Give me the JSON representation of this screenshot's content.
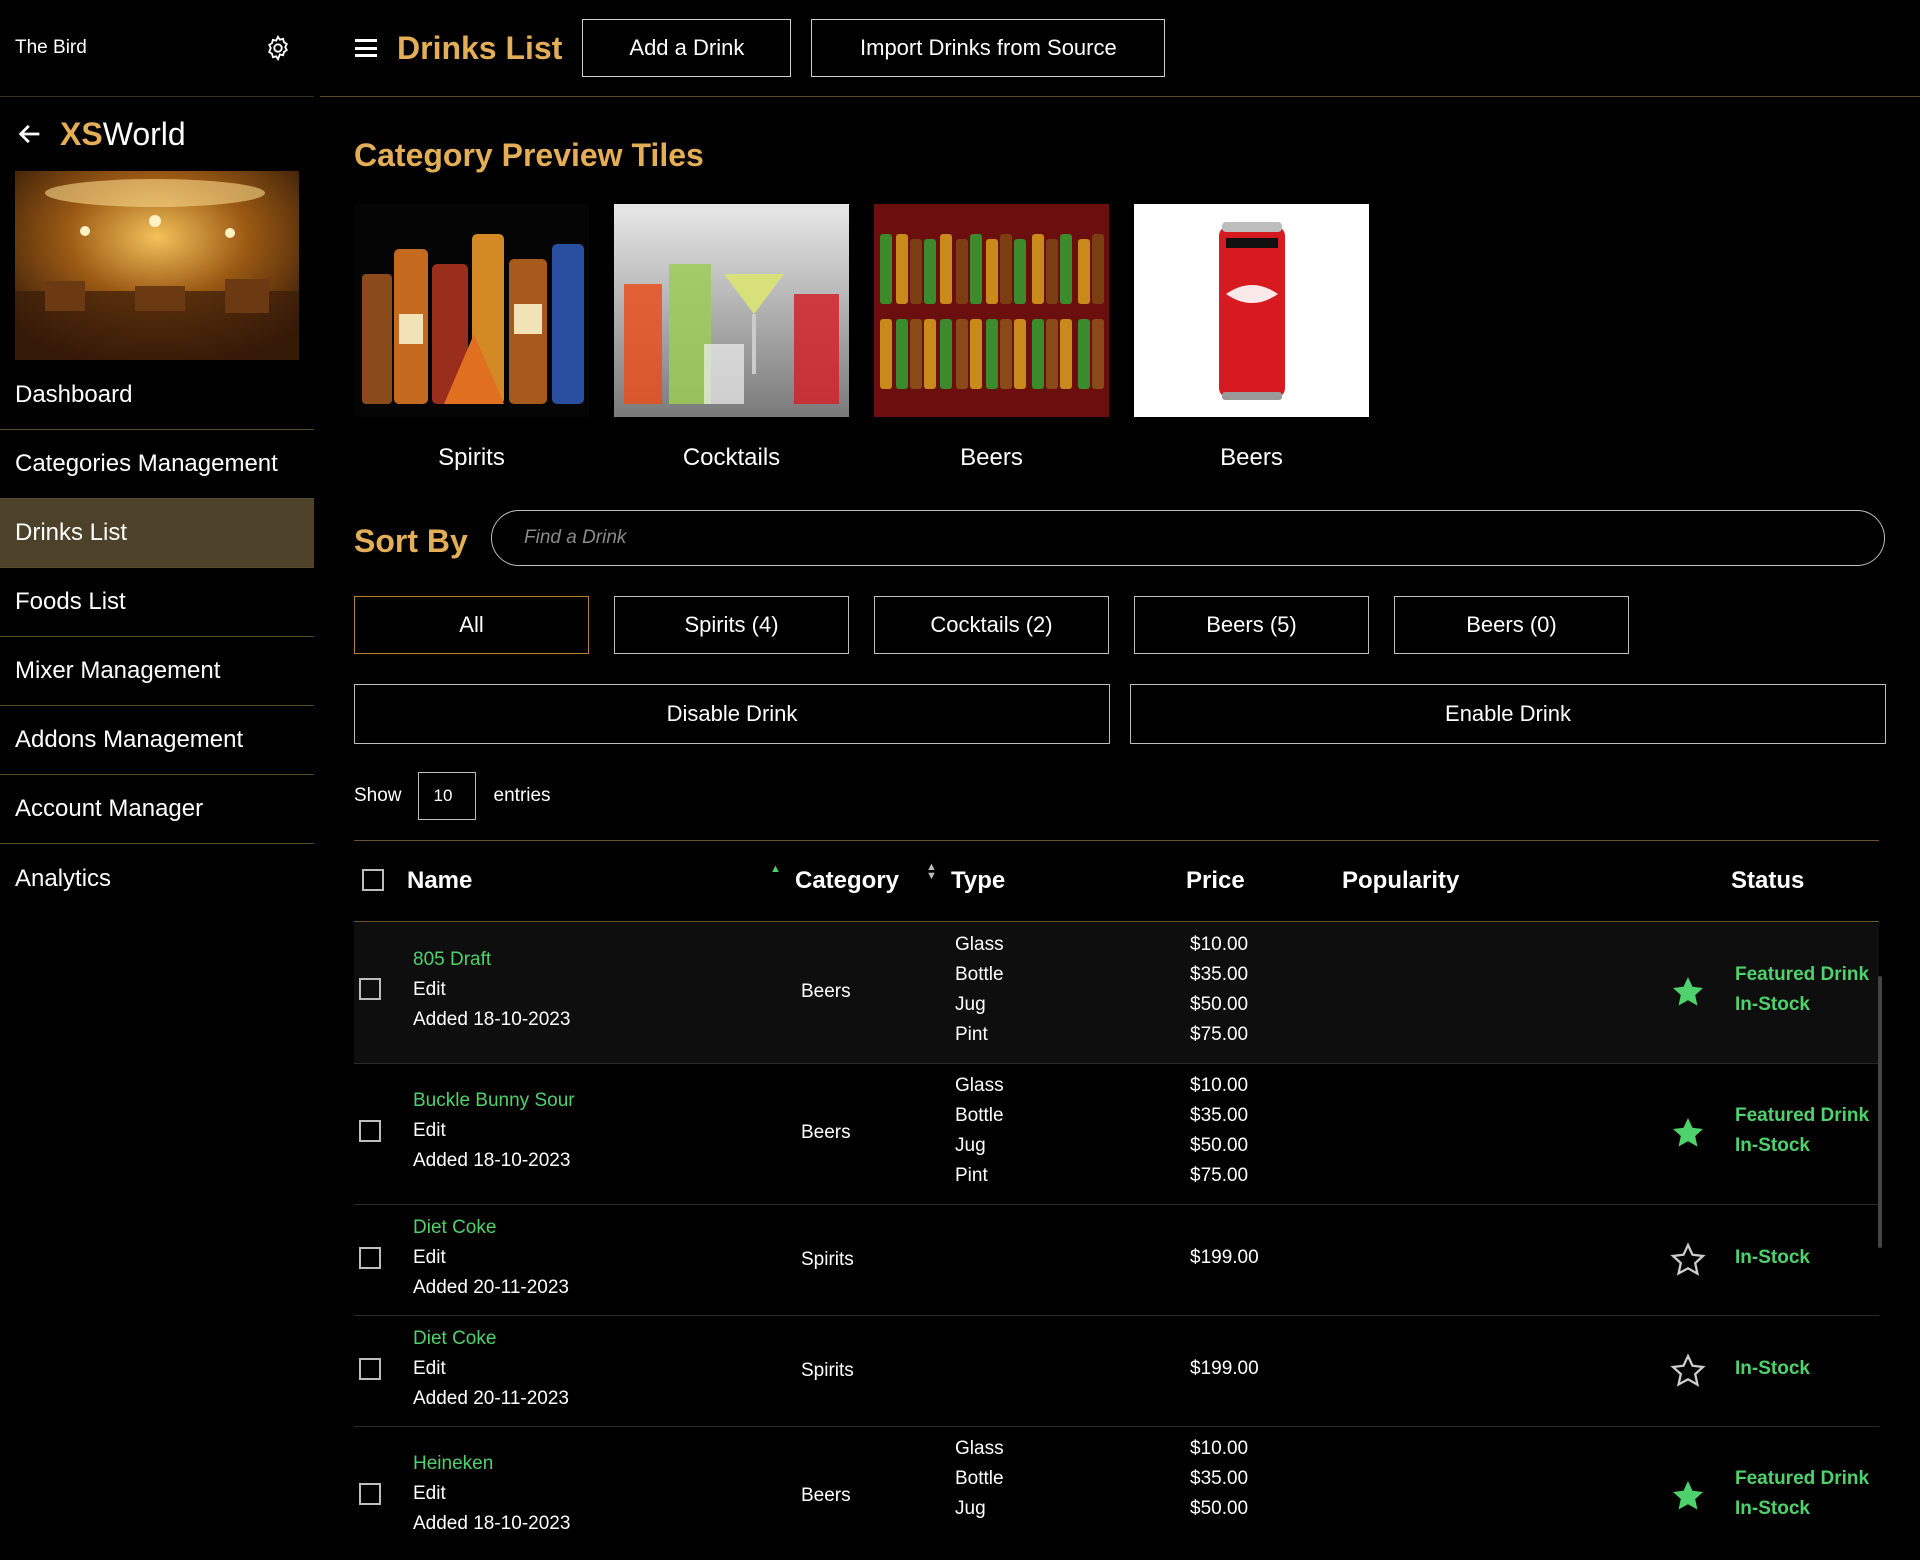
{
  "sidebar": {
    "venue": "The Bird",
    "brand_prefix": "XS",
    "brand_suffix": "World",
    "menu": [
      "Dashboard",
      "Categories Management",
      "Drinks List",
      "Foods List",
      "Mixer Management",
      "Addons Management",
      "Account Manager",
      "Analytics"
    ],
    "active_item": "Drinks List"
  },
  "header": {
    "title": "Drinks List",
    "add_button": "Add a Drink",
    "import_button": "Import Drinks from Source"
  },
  "tiles": {
    "title": "Category Preview Tiles",
    "items": [
      "Spirits",
      "Cocktails",
      "Beers",
      "Beers"
    ]
  },
  "sort": {
    "label": "Sort By",
    "search_placeholder": "Find a Drink",
    "filters": [
      "All",
      "Spirits (4)",
      "Cocktails (2)",
      "Beers (5)",
      "Beers (0)"
    ],
    "disable": "Disable Drink",
    "enable": "Enable Drink"
  },
  "entries": {
    "show": "Show",
    "count": "10",
    "suffix": "entries"
  },
  "table": {
    "headers": {
      "name": "Name",
      "category": "Category",
      "type": "Type",
      "price": "Price",
      "popularity": "Popularity",
      "status": "Status"
    },
    "rows": [
      {
        "name": "805 Draft",
        "edit": "Edit",
        "added": "Added 18-10-2023",
        "category": "Beers",
        "types": [
          "Glass",
          "Bottle",
          "Jug",
          "Pint"
        ],
        "prices": [
          "$10.00",
          "$35.00",
          "$50.00",
          "$75.00"
        ],
        "featured": "Featured Drink",
        "stock": "In-Stock"
      },
      {
        "name": "Buckle Bunny Sour",
        "edit": "Edit",
        "added": "Added 18-10-2023",
        "category": "Beers",
        "types": [
          "Glass",
          "Bottle",
          "Jug",
          "Pint"
        ],
        "prices": [
          "$10.00",
          "$35.00",
          "$50.00",
          "$75.00"
        ],
        "featured": "Featured Drink",
        "stock": "In-Stock"
      },
      {
        "name": "Diet Coke",
        "edit": "Edit",
        "added": "Added 20-11-2023",
        "category": "Spirits",
        "types": [],
        "prices": [
          "$199.00"
        ],
        "featured": "",
        "stock": "In-Stock"
      },
      {
        "name": "Diet Coke",
        "edit": "Edit",
        "added": "Added 20-11-2023",
        "category": "Spirits",
        "types": [],
        "prices": [
          "$199.00"
        ],
        "featured": "",
        "stock": "In-Stock"
      },
      {
        "name": "Heineken",
        "edit": "Edit",
        "added": "Added 18-10-2023",
        "category": "Beers",
        "types": [
          "Glass",
          "Bottle",
          "Jug"
        ],
        "prices": [
          "$10.00",
          "$35.00",
          "$50.00"
        ],
        "featured": "Featured Drink",
        "stock": "In-Stock"
      }
    ]
  },
  "colors": {
    "accent": "#e3ae55",
    "green": "#4fd26b",
    "active_bg": "#4d4229"
  }
}
